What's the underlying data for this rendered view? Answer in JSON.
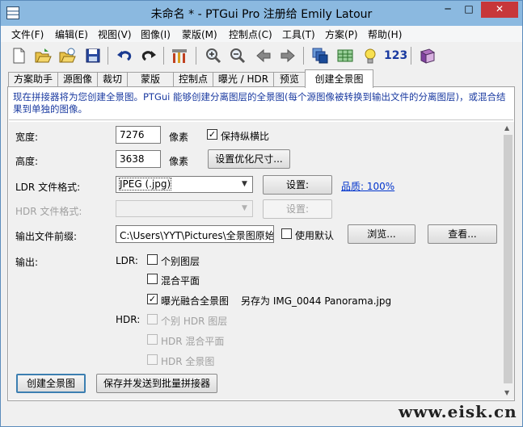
{
  "window": {
    "title": "未命名 * - PTGui Pro 注册给 Emily Latour",
    "minimize": "─",
    "maximize": "□",
    "close": "✕"
  },
  "menu": [
    "文件(F)",
    "编辑(E)",
    "视图(V)",
    "图像(I)",
    "蒙版(M)",
    "控制点(C)",
    "工具(T)",
    "方案(P)",
    "帮助(H)"
  ],
  "toolbar": {
    "icons": [
      "new-icon",
      "open-icon",
      "open-recent-icon",
      "save-icon",
      "undo-icon",
      "redo-icon",
      "tools-icon",
      "zoom-in-icon",
      "zoom-out-icon",
      "back-icon",
      "forward-icon",
      "layers-icon",
      "table-icon",
      "bulb-icon",
      "numbers-icon",
      "book-icon"
    ],
    "numbers_label": "123"
  },
  "tabs": [
    "方案助手",
    "源图像",
    "裁切",
    "蒙版",
    "控制点",
    "曝光 / HDR",
    "预览",
    "创建全景图"
  ],
  "active_tab": "创建全景图",
  "info": "现在拼接器将为您创建全景图。PTGui 能够创建分离图层的全景图(每个源图像被转换到输出文件的分离图层)，或混合结果到单独的图像。",
  "form": {
    "width_label": "宽度:",
    "width_value": "7276",
    "width_unit": "像素",
    "keep_ratio_label": "保持纵横比",
    "keep_ratio_checked": true,
    "height_label": "高度:",
    "height_value": "3638",
    "height_unit": "像素",
    "optimize_size_button": "设置优化尺寸...",
    "ldr_format_label": "LDR 文件格式:",
    "ldr_format_value": "JPEG (.jpg)",
    "ldr_settings_button": "设置:",
    "quality_link": "品质: 100%",
    "hdr_format_label": "HDR 文件格式:",
    "hdr_format_value": "",
    "hdr_settings_button": "设置:",
    "output_prefix_label": "输出文件前缀:",
    "output_prefix_value": "C:\\Users\\YYT\\Pictures\\全景图原始",
    "use_default_label": "使用默认",
    "browse_button": "浏览...",
    "view_button": "查看...",
    "output_label": "输出:",
    "ldr_label": "LDR:",
    "individual_layers": "个别图层",
    "blended_planes": "混合平面",
    "exposure_fused": "曝光融合全景图",
    "save_as_text": "另存为 IMG_0044 Panorama.jpg",
    "hdr_label": "HDR:",
    "hdr_individual_layers": "个别 HDR 图层",
    "hdr_blended_planes": "HDR 混合平面",
    "hdr_panorama": "HDR 全景图",
    "create_button": "创建全景图",
    "batch_button": "保存并发送到批量拼接器"
  },
  "watermark": "www.eisk.cn",
  "colors": {
    "title_bar": "#8bb9e0",
    "close": "#c7373a",
    "info_text": "#1a3aa0",
    "link": "#0033cc"
  }
}
